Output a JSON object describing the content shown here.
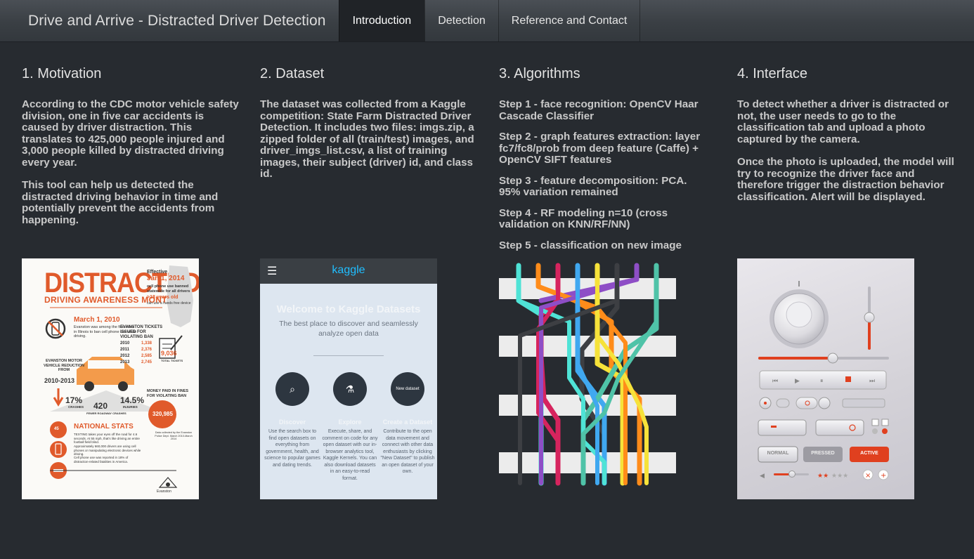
{
  "nav": {
    "brand": "Drive and Arrive - Distracted Driver Detection",
    "tabs": [
      {
        "label": "Introduction",
        "active": true
      },
      {
        "label": "Detection",
        "active": false
      },
      {
        "label": "Reference and Contact",
        "active": false
      }
    ]
  },
  "sections": [
    {
      "title": "1. Motivation",
      "paragraphs": [
        "According to the CDC motor vehicle safety division, one in five car accidents is caused by driver distraction. This translates to 425,000 people injured and 3,000 people killed by distracted driving every year.",
        "This tool can help us detected the distracted driving behavior in time and potentially prevent the accidents from happening."
      ]
    },
    {
      "title": "2. Dataset",
      "paragraphs": [
        "The dataset was collected from a Kaggle competition: State Farm Distracted Driver Detection. It includes two files: imgs.zip, a zipped folder of all (train/test) images, and driver_imgs_list.csv, a list of training images, their subject (driver) id, and class id."
      ]
    },
    {
      "title": "3. Algorithms",
      "paragraphs": [
        "Step 1 - face recognition: OpenCV Haar Cascade Classifier",
        "Step 2 - graph features extraction: layer fc7/fc8/prob from deep feature (Caffe) + OpenCV SIFT features",
        "Step 3 - feature decomposition: PCA. 95% variation remained",
        "Step 4 - RF modeling n=10 (cross validation on KNN/RF/NN)",
        "Step 5 - classification on new image"
      ]
    },
    {
      "title": "4. Interface",
      "paragraphs": [
        "To detect whether a driver is distracted or not, the user needs to go to the classification tab and upload a photo captured by the camera.",
        "Once the photo is uploaded, the model will try to recognize the driver face and therefore trigger the distraction behavior classification. Alert will be displayed."
      ]
    }
  ],
  "infographic": {
    "title": "DISTRACTED",
    "subtitle": "DRIVING AWARENESS MONTH",
    "effective": "Effective",
    "effective_date": "Jan 1, 2014",
    "law_note": "cell phone use banned statewide for all drivers",
    "age_note": ">18 years old",
    "hands_free": "can use a hands free device",
    "march": "March 1, 2010",
    "march_note": "Evanston was among the first cities in Illinois to ban cell phone use while driving.",
    "tickets_title": "EVANSTON TICKETS ISSUED FOR VIOLATING BAN",
    "tickets": [
      {
        "year": "2010",
        "count": "1,338"
      },
      {
        "year": "2011",
        "count": "2,376"
      },
      {
        "year": "2012",
        "count": "2,585"
      },
      {
        "year": "2013",
        "count": "2,745"
      }
    ],
    "total_tickets": "9,036",
    "total_tickets_label": "TOTAL TICKETS",
    "reduction_title": "EVANSTON MOTOR VEHICLE REDUCTION FROM",
    "reduction_years": "2010-2013",
    "crashes_pct": "17%",
    "crashes_label": "CRASHES",
    "injuries_pct": "14.5%",
    "injuries_label": "INJURIES",
    "fewer": "420",
    "fewer_label": "FEWER ROADWAY CRASHES",
    "fines_title": "MONEY PAID IN FINES FOR VIOLATING BAN",
    "fines_total": "320,985",
    "fines_note": "Data collected by the Evanston Police Dept. March 2010-March 2014",
    "national_title": "NATIONAL STATS",
    "national_1": "TEXTING takes your eyes off the road for 4.6 seconds. At 55 mph, that's like driving an entire football field blind.",
    "national_2": "Approximately 660,000 drivers are using cell phones or manipulating electronic devices while driving.",
    "national_3": "Cell phone use was reported in 18% of distraction-related fatalities in America.",
    "badge_num": "45",
    "city": "Evanston"
  },
  "kaggle": {
    "logo": "kaggle",
    "menu_icon": "☰",
    "welcome": "Welcome to Kaggle Datasets",
    "tagline": "The best place to discover and seamlessly analyze open data",
    "new_dataset": "New dataset",
    "cards": [
      {
        "title": "Discover",
        "desc": "Use the search box to find open datasets on everything from government, health, and science to popular games and dating trends."
      },
      {
        "title": "Explore",
        "desc": "Execute, share, and comment on code for any open dataset with our in-browser analytics tool, Kaggle Kernels. You can also download datasets in an easy-to-read format."
      },
      {
        "title": "Create a Dataset",
        "desc": "Contribute to the open data movement and connect with other data enthusiasts by clicking \"New Dataset\" to publish an open dataset of your own."
      }
    ]
  },
  "uikit": {
    "btn_normal": "NORMAL",
    "btn_pressed": "PRESSED",
    "btn_active": "ACTIVE",
    "accent": "#e0401f"
  },
  "line_colors": [
    "#f0f0f0",
    "#4fe3d6",
    "#ff8c1a",
    "#d6245e",
    "#8e4ec6",
    "#40a8f0",
    "#4fc3a8",
    "#f6e23a",
    "#3d3f43",
    "#6c5ce7"
  ]
}
